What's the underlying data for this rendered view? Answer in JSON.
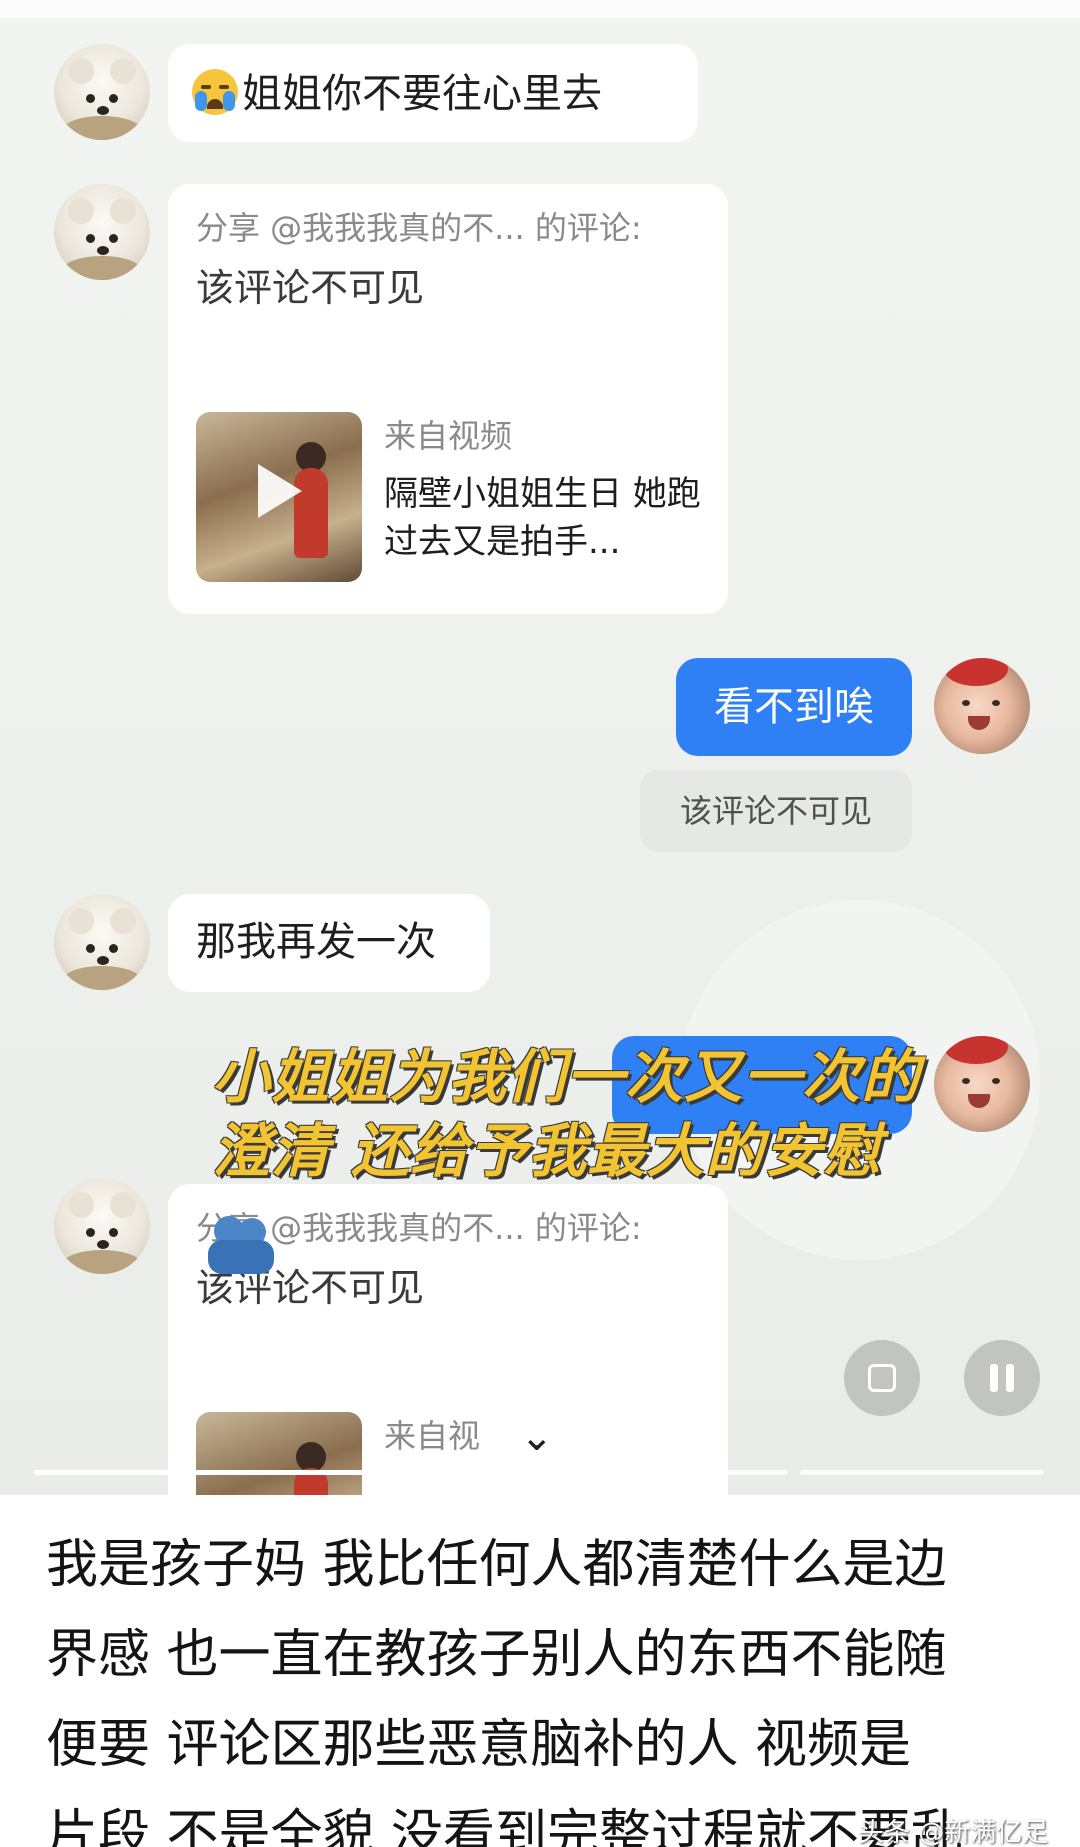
{
  "chat": {
    "message_1": {
      "text": "姐姐你不要往心里去"
    },
    "share_card_1": {
      "header": "分享 @我我我真的不... 的评论:",
      "body": "该评论不可见",
      "video_source": "来自视频",
      "video_title": "隔壁小姐姐生日 她跑过去又是拍手..."
    },
    "reply_blue": {
      "text": "看不到唉"
    },
    "hidden_chip": {
      "text": "该评论不可见"
    },
    "message_3": {
      "text": "那我再发一次"
    },
    "share_card_2": {
      "header": "分享 @我我我真的不... 的评论:",
      "body": "该评论不可见",
      "video_source": "来自视"
    }
  },
  "caption_overlay": {
    "line_1": "小姐姐为我们一次又一次的",
    "line_2": "澄清 还给予我最大的安慰"
  },
  "video_controls": {
    "scan_icon": "scan-icon",
    "pause_icon": "pause-icon",
    "expand_icon": "chevron-down-icon"
  },
  "post_text": {
    "line_1": "我是孩子妈 我比任何人都清楚什么是边",
    "line_2": "界感  也一直在教孩子别人的东西不能随",
    "line_3": "便要  评论区那些恶意脑补的人 视频是",
    "line_4": "片段 不是全貌 没看到完整过程就不要乱"
  },
  "watermark": "头条 @新满亿足",
  "colors": {
    "blue_bubble": "#2f7ff5",
    "caption_yellow": "#f3c431",
    "chat_background": "#eef1ee"
  }
}
